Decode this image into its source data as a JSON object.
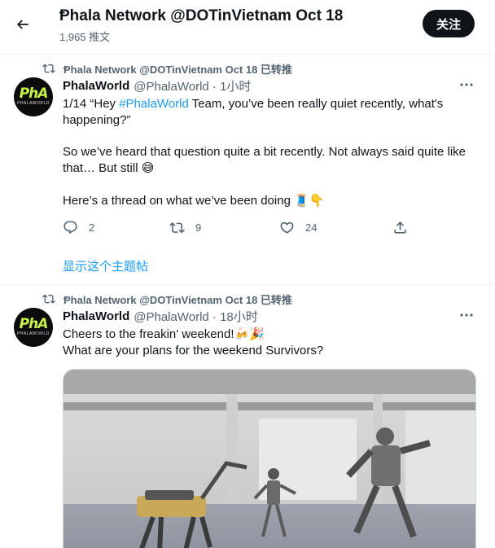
{
  "header": {
    "title": "Ᵽhala Network @DOTinVietnam Oct 18",
    "subtitle": "1,965 推文",
    "follow_label": "关注"
  },
  "avatar": {
    "logo_text": "PhA",
    "logo_sub": "PHALAWORLD"
  },
  "tweets": [
    {
      "retweet_line": "Ᵽhala Network @DOTinVietnam Oct 18 已转推",
      "name": "PhalaWorld",
      "handle_time": "@PhalaWorld · 1小时",
      "line1_pre": "1/14 “Hey ",
      "hashtag": "#PhalaWorld",
      "line1_post": " Team, you’ve been really quiet recently, what's happening?”",
      "para2": "So we’ve heard that question quite a bit recently. Not always said quite like that… But still 😅",
      "para3": "Here’s a thread on what we’ve been doing 🧵👇",
      "reply_count": "2",
      "retweet_count": "9",
      "like_count": "24",
      "show_thread": "显示这个主题帖"
    },
    {
      "retweet_line": "Ᵽhala Network @DOTinVietnam Oct 18 已转推",
      "name": "PhalaWorld",
      "handle_time": "@PhalaWorld · 18小时",
      "line1": "Cheers to the freakin' weekend!🍻🎉",
      "line2": "What are your plans for the weekend Survivors?"
    }
  ],
  "icons": {
    "back": "arrow-left-icon",
    "retweet": "retweet-icon",
    "more": "more-dots-icon",
    "reply": "reply-icon",
    "like": "heart-icon",
    "share": "share-icon"
  },
  "colors": {
    "accent": "#1d9bf0",
    "text": "#0f1419",
    "muted": "#536471",
    "logo": "#c6ef4a"
  }
}
